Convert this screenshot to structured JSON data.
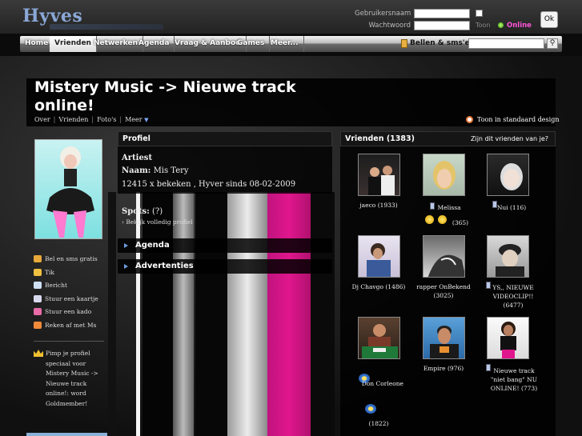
{
  "header": {
    "logo": "Hyves",
    "username_label": "Gebruikersnaam",
    "password_label": "Wachtwoord",
    "toon_label": "Toon",
    "online_label": "Online",
    "ok_label": "Ok"
  },
  "nav": {
    "items": [
      "Home",
      "Vrienden",
      "Netwerken",
      "Agenda",
      "Vraag & Aanbod",
      "Games",
      "Meer..."
    ],
    "active": "Vrienden",
    "bellen_label": "Bellen & sms'en"
  },
  "page": {
    "title": "Mistery Music -> Nieuwe track online!",
    "subnav": [
      "Over",
      "Vrienden",
      "Foto's",
      "Meer"
    ],
    "design_link": "Toon in standaard design"
  },
  "sidebar": {
    "actions": [
      {
        "label": "Bel en sms gratis",
        "icon": "phone-icon",
        "color": "#e8a83a"
      },
      {
        "label": "Tik",
        "icon": "tik-hand-icon",
        "color": "#f0c040"
      },
      {
        "label": "Bericht",
        "icon": "envelope-icon",
        "color": "#cfe0f5"
      },
      {
        "label": "Stuur een kaartje",
        "icon": "card-icon",
        "color": "#d9d9f0"
      },
      {
        "label": "Stuur een kado",
        "icon": "gift-icon",
        "color": "#e86aa8"
      },
      {
        "label": "Reken af met Ms",
        "icon": "calendar-icon",
        "color": "#f08a3a"
      }
    ],
    "pimp_text": "Pimp je profiel speciaal voor Mistery Music -> Nieuwe track online!: word Goldmember!"
  },
  "profile": {
    "header": "Profiel",
    "type": "Artiest",
    "name_label": "Naam:",
    "name_value": "Mis Tery",
    "stats": "12415 x bekeken , Hyver sinds 08-02-2009",
    "spots_label": "Spots:",
    "spots_value": "(?)",
    "full_profile_link": "Bekijk volledig profiel",
    "agenda_label": "Agenda",
    "ads_label": "Advertenties"
  },
  "friends": {
    "header": "Vrienden (1383)",
    "link": "Zijn dit vrienden van je?",
    "items": [
      {
        "name": "jaeco (1933)"
      },
      {
        "name": "Melissa",
        "extra": "(365)"
      },
      {
        "name": "Nui (116)"
      },
      {
        "name": "Dj Chavgo (1486)"
      },
      {
        "name": "rapper OnBekend (3025)"
      },
      {
        "name": "YS,, NIEUWE VIDEOCLIP!! (6477)"
      },
      {
        "name": "Don Corleone",
        "extra": "(1822)"
      },
      {
        "name": "Empire (976)"
      },
      {
        "name": "Nieuwe track \"niet bang\" NU ONLINE! (773)"
      }
    ]
  }
}
